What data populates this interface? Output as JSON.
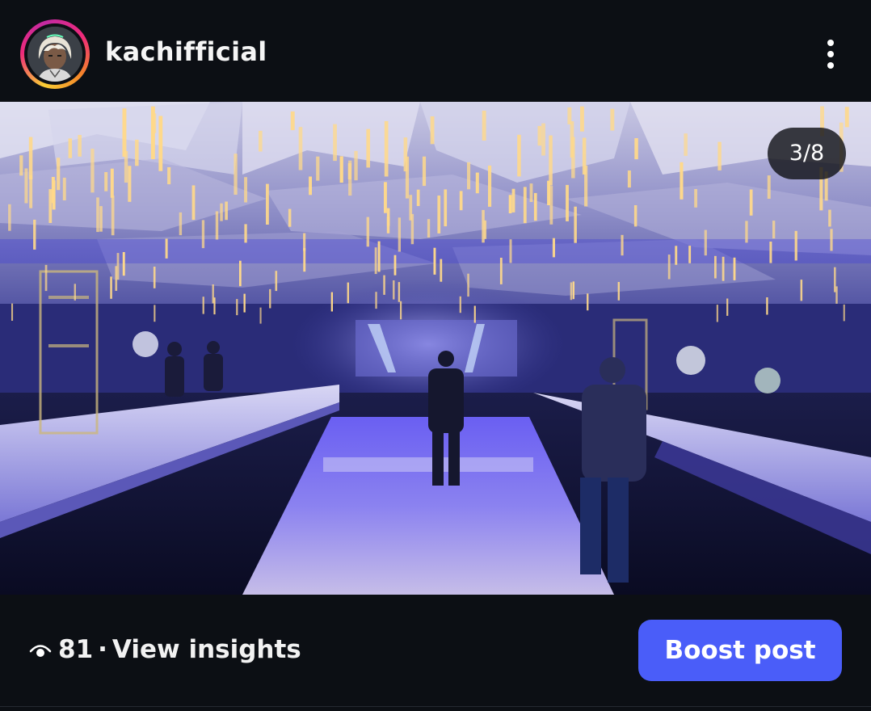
{
  "post": {
    "username": "kachifficial",
    "avatar_icon": "avatar-image",
    "more_icon": "more-vertical-icon",
    "photo_description_icon": "post-photo",
    "carousel": {
      "current": 3,
      "total": 8,
      "label": "3/8"
    }
  },
  "footer": {
    "eye_icon": "eye-icon",
    "views": "81",
    "separator": "·",
    "insights_label": "View insights",
    "boost_label": "Boost post"
  },
  "colors": {
    "background": "#0c0f14",
    "boost_button": "#4a5df9",
    "ring_gradient": [
      "#f9ce34",
      "#ee2a7b",
      "#c32aa3"
    ]
  }
}
